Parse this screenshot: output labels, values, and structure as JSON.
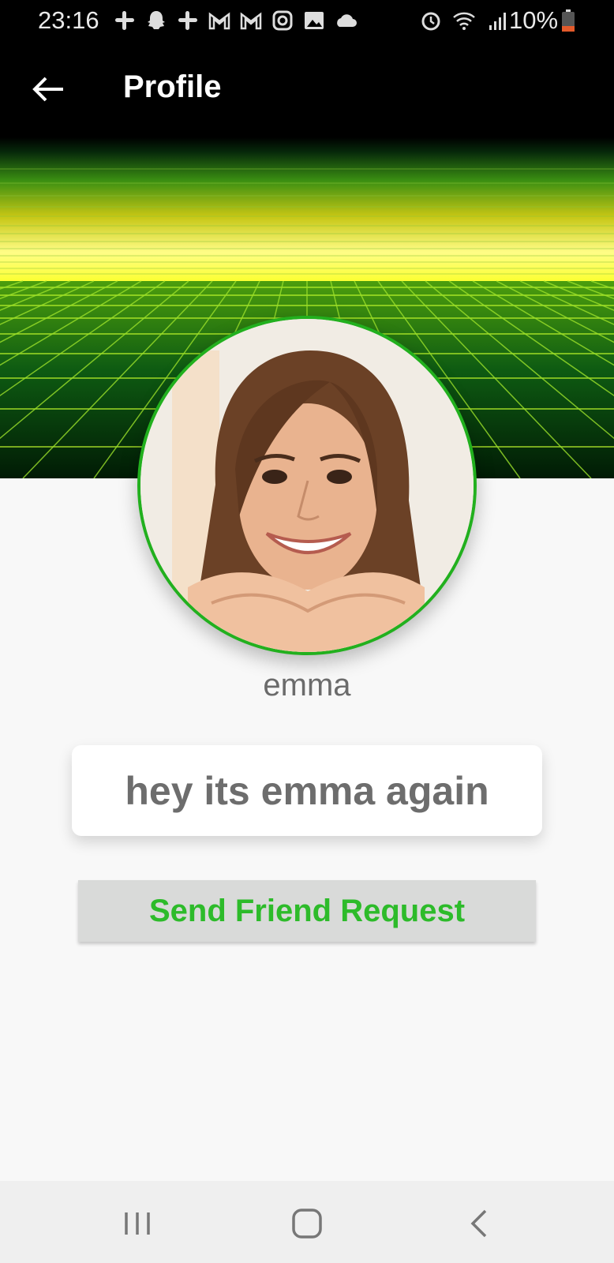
{
  "status_bar": {
    "time": "23:16",
    "battery_text": "10%",
    "left_icons": [
      "slack-icon",
      "snapchat-icon",
      "slack-icon",
      "gmail-icon",
      "gmail-icon",
      "instagram-icon",
      "gallery-icon",
      "cloud-icon"
    ],
    "right_icons": [
      "alarm-icon",
      "wifi-icon",
      "signal-icon",
      "battery-icon"
    ]
  },
  "app_bar": {
    "title": "Profile",
    "back_icon": "arrow-left-icon"
  },
  "profile": {
    "username": "emma",
    "status_message": "hey its emma again",
    "friend_request_label": "Send Friend Request"
  },
  "nav_bar": {
    "icons": [
      "recent-apps-icon",
      "home-icon",
      "back-icon"
    ]
  },
  "colors": {
    "accent_green": "#2dbb2a",
    "avatar_border": "#22b01e",
    "app_bar": "#000000",
    "button_bg": "#d9dad9"
  }
}
